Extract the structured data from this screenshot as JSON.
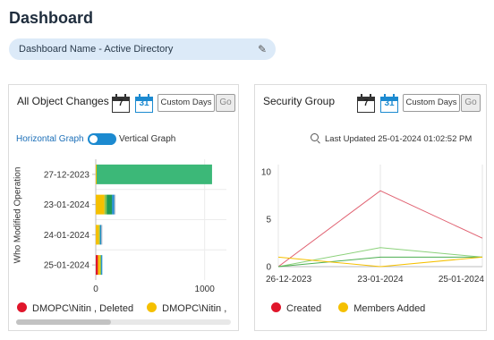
{
  "page": {
    "title": "Dashboard"
  },
  "dashboard_selector": {
    "label": "Dashboard Name - Active Directory",
    "edit_icon": "pencil-icon"
  },
  "cards": {
    "all_object_changes": {
      "title": "All Object Changes",
      "cal_week_num": "7",
      "cal_month_num": "31",
      "custom_days_label": "Custom Days",
      "go_label": "Go",
      "toggle_left_label": "Horizontal Graph",
      "toggle_right_label": "Vertical Graph",
      "ylabel": "Who Modified Operation",
      "legend": [
        {
          "label": "DMOPC\\Nitin , Deleted",
          "color": "#e0162b"
        },
        {
          "label": "DMOPC\\Nitin ,",
          "color": "#f5c000"
        }
      ]
    },
    "security_group": {
      "title": "Security Group",
      "cal_week_num": "7",
      "cal_month_num": "31",
      "custom_days_label": "Custom Days",
      "go_label": "Go",
      "last_updated": "Last Updated 25-01-2024 01:02:52 PM",
      "legend": [
        {
          "label": "Created",
          "color": "#e0162b"
        },
        {
          "label": "Members Added",
          "color": "#f5c000"
        }
      ]
    }
  },
  "chart_data": [
    {
      "type": "bar",
      "orientation": "horizontal",
      "stacked": true,
      "categories": [
        "27-12-2023",
        "23-01-2024",
        "24-01-2024",
        "25-01-2024"
      ],
      "xlim": [
        0,
        1200
      ],
      "xticks": [
        0,
        1000
      ],
      "ylabel": "Who Modified Operation",
      "series": [
        {
          "name": "DMOPC\\Nitin , Deleted",
          "color": "#e0162b",
          "values": [
            0,
            0,
            0,
            20
          ]
        },
        {
          "name": "DMOPC\\Nitin ,",
          "color": "#f5c000",
          "values": [
            8,
            80,
            30,
            20
          ]
        },
        {
          "color": "#8bc34a",
          "values": [
            0,
            20,
            10,
            10
          ]
        },
        {
          "color": "#1e9a52",
          "values": [
            0,
            50,
            0,
            0
          ]
        },
        {
          "color": "#3cb878",
          "values": [
            1060,
            0,
            0,
            0
          ]
        },
        {
          "color": "#1c8ad0",
          "values": [
            0,
            20,
            10,
            10
          ]
        },
        {
          "color": "#a9b7c6",
          "values": [
            0,
            10,
            10,
            0
          ]
        }
      ]
    },
    {
      "type": "line",
      "x": [
        "26-12-2023",
        "23-01-2024",
        "25-01-2024"
      ],
      "ylim": [
        0,
        10
      ],
      "yticks": [
        0,
        5,
        10
      ],
      "grid": true,
      "series": [
        {
          "name": "Created",
          "color": "#e06070",
          "values": [
            0,
            8,
            3
          ]
        },
        {
          "color": "#8bd17a",
          "values": [
            0,
            2,
            1
          ]
        },
        {
          "color": "#4caf50",
          "values": [
            0,
            1,
            1
          ]
        },
        {
          "name": "Members Added",
          "color": "#f5c000",
          "values": [
            1,
            0,
            1
          ]
        }
      ]
    }
  ]
}
